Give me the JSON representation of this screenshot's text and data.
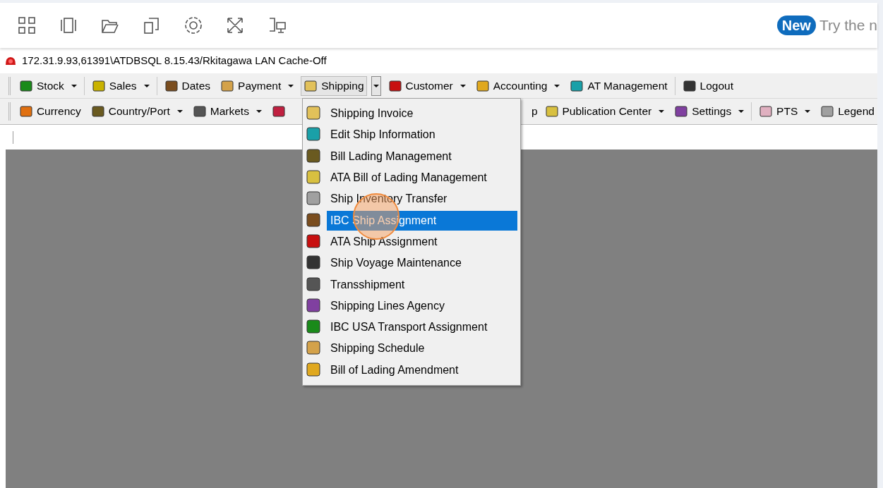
{
  "top_bar": {
    "badge": "New",
    "promo": "Try the n"
  },
  "connection": {
    "title": "172.31.9.93,61391\\ATDBSQL 8.15.43/Rkitagawa LAN Cache-Off"
  },
  "toolbar_1": [
    {
      "label": "Stock",
      "dropdown": true,
      "selected": false
    },
    {
      "label": "Sales",
      "dropdown": true,
      "selected": false
    },
    {
      "label": "Dates",
      "dropdown": false,
      "selected": false
    },
    {
      "label": "Payment",
      "dropdown": true,
      "selected": false
    },
    {
      "label": "Shipping",
      "dropdown": true,
      "selected": true
    },
    {
      "label": "Customer",
      "dropdown": true,
      "selected": false
    },
    {
      "label": "Accounting",
      "dropdown": true,
      "selected": false
    },
    {
      "label": "AT Management",
      "dropdown": false,
      "selected": false
    },
    {
      "label": "Logout",
      "dropdown": false,
      "selected": false
    }
  ],
  "toolbar_2_left": [
    {
      "label": "Currency",
      "dropdown": false
    },
    {
      "label": "Country/Port",
      "dropdown": true
    },
    {
      "label": "Markets",
      "dropdown": true
    },
    {
      "dropdown": false
    }
  ],
  "toolbar_2_right": [
    {
      "label": "p"
    },
    {
      "label": "Publication Center",
      "dropdown": true
    },
    {
      "label": "Settings",
      "dropdown": true
    },
    {
      "label": "PTS",
      "dropdown": true
    },
    {
      "label": "Legend",
      "dropdown": false
    }
  ],
  "shipping_menu": [
    {
      "label": "Shipping Invoice",
      "selected": false
    },
    {
      "label": "Edit Ship Information",
      "selected": false
    },
    {
      "label": "Bill Lading Management",
      "selected": false
    },
    {
      "label": "ATA Bill of Lading Management",
      "selected": false
    },
    {
      "label": "Ship Inventory Transfer",
      "selected": false
    },
    {
      "label": "IBC Ship Assignment",
      "selected": true
    },
    {
      "label": "ATA Ship Assignment",
      "selected": false
    },
    {
      "label": "Ship Voyage Maintenance",
      "selected": false
    },
    {
      "label": "Transshipment",
      "selected": false
    },
    {
      "label": "Shipping Lines Agency",
      "selected": false
    },
    {
      "label": "IBC USA Transport Assignment",
      "selected": false
    },
    {
      "label": "Shipping Schedule",
      "selected": false
    },
    {
      "label": "Bill of Lading Amendment",
      "selected": false
    }
  ]
}
